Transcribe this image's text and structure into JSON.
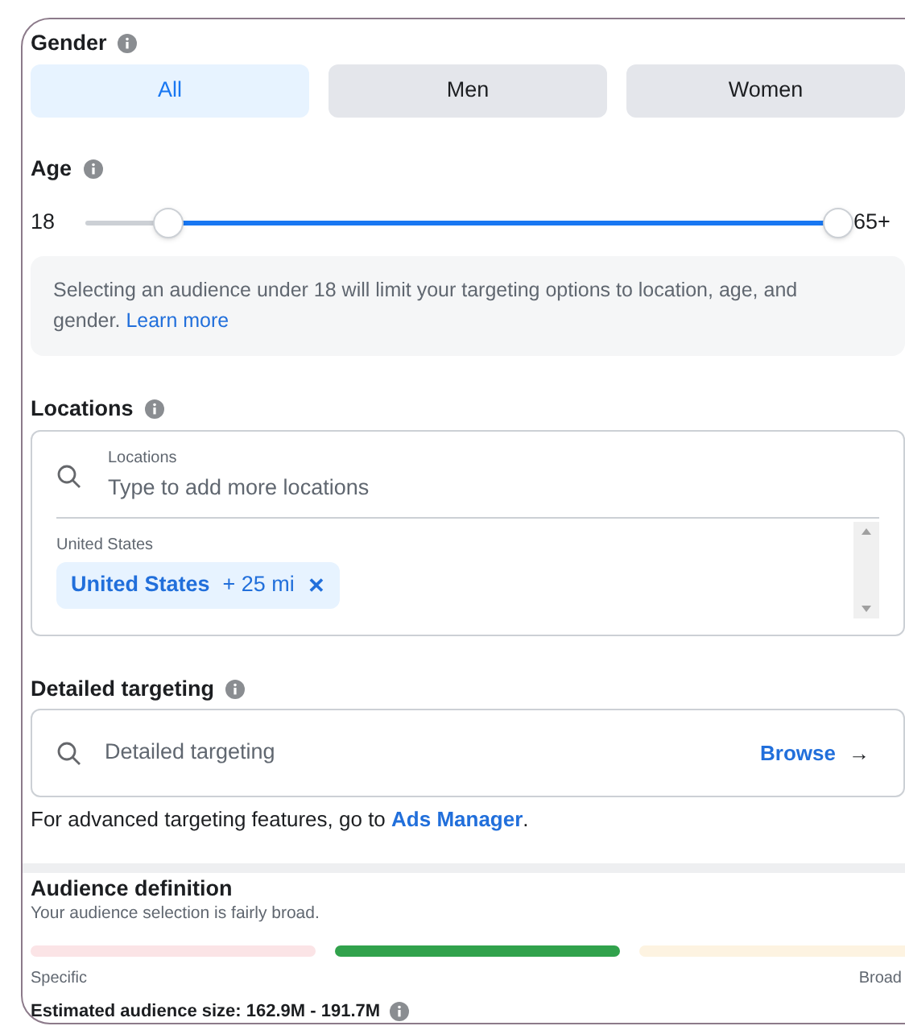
{
  "gender": {
    "label": "Gender",
    "options": [
      {
        "label": "All",
        "selected": true
      },
      {
        "label": "Men",
        "selected": false
      },
      {
        "label": "Women",
        "selected": false
      }
    ]
  },
  "age": {
    "label": "Age",
    "min_label": "18",
    "max_label": "65+",
    "thumbs": [
      {
        "level": 0.11
      },
      {
        "level": 1.0
      }
    ]
  },
  "notice": {
    "text": "Selecting an audience under 18 will limit your targeting options to location, age, and gender.",
    "link": "Learn more"
  },
  "locations": {
    "label": "Locations",
    "search_label": "Locations",
    "placeholder": "Type to add more locations",
    "group": "United States",
    "tags": [
      {
        "name": "United States",
        "radius": "+ 25 mi",
        "remove": "✕"
      }
    ]
  },
  "detailed_targeting": {
    "label": "Detailed targeting",
    "placeholder": "Detailed targeting",
    "browse": "Browse",
    "arrow": "→",
    "note": "For advanced targeting features, go to",
    "note_link": "Ads Manager",
    "note_end": "."
  },
  "audience": {
    "title": "Audience definition",
    "subtitle": "Your audience selection is fairly broad.",
    "segments": [
      {
        "selected": false
      },
      {
        "selected": true
      },
      {
        "selected": false
      }
    ],
    "left_label": "Specific",
    "right_label": "Broad",
    "size": "Estimated audience size: 162.9M - 191.7M"
  }
}
